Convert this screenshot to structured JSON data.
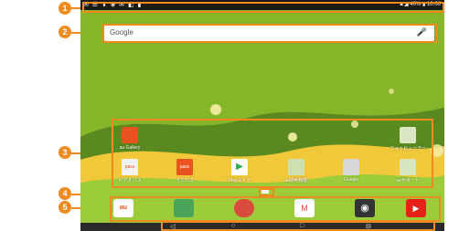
{
  "callouts": [
    "1",
    "2",
    "3",
    "4",
    "5"
  ],
  "status_bar": {
    "left_icons": "✉ ☰ ⬇ ◈ ✉ ◧ ▮",
    "right_text": "▲◢ 40% ▮ 10:00"
  },
  "search": {
    "logo": "Google",
    "mic": "🎤"
  },
  "apps_row1": [
    {
      "label": "au Gallery",
      "color": "#e8531f"
    },
    {
      "label": "",
      "color": "#eeeeee"
    },
    {
      "label": "",
      "color": "#eeeeee"
    },
    {
      "label": "",
      "color": "#eeeeee"
    },
    {
      "label": "",
      "color": "#eeeeee"
    },
    {
      "label": "フォトビューアー",
      "color": "#dbe6c2"
    }
  ],
  "apps_row2": [
    {
      "label": "ビデオパス",
      "color": "#f3f3f3",
      "text": "pass"
    },
    {
      "label": "うたパス",
      "color": "#e8531f",
      "text": "pass"
    },
    {
      "label": "Playストア",
      "color": "#ffffff",
      "text": "▶"
    },
    {
      "label": "au便利機能",
      "color": "#cfe0b0",
      "text": ""
    },
    {
      "label": "Google",
      "color": "#d8d8d8",
      "text": ""
    },
    {
      "label": "auサポート",
      "color": "#d8e6c0",
      "text": ""
    }
  ],
  "dock": [
    {
      "label": "au",
      "color": "#e8531f",
      "text": "au"
    },
    {
      "label": "maps",
      "color": "#4aa55a",
      "text": ""
    },
    {
      "label": "chrome",
      "color": "#d94b3c",
      "text": ""
    },
    {
      "label": "gmail",
      "color": "#ffffff",
      "text": "M"
    },
    {
      "label": "camera",
      "color": "#333333",
      "text": "◉"
    },
    {
      "label": "youtube",
      "color": "#e62117",
      "text": "▶"
    }
  ],
  "nav": {
    "back": "◁",
    "home": "○",
    "recents": "□",
    "menu": "⊟"
  },
  "colors": {
    "accent": "#ef8a1e",
    "wallpaper": "#8dbb2c"
  }
}
